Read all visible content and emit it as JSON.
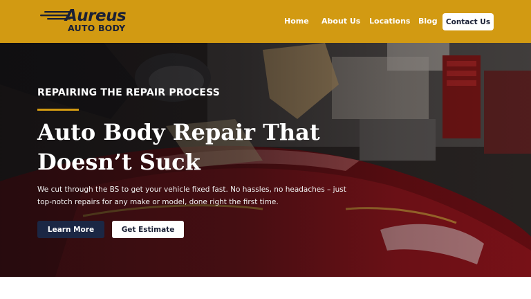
{
  "brand": {
    "logo_word": "Aureus",
    "logo_sub": "AUTO BODY",
    "colors": {
      "header_bg": "#d29a12",
      "navy": "#1b2744",
      "accent_rule": "#d29a12"
    }
  },
  "nav": {
    "items": [
      {
        "label": "Home"
      },
      {
        "label": "About Us"
      },
      {
        "label": "Locations"
      },
      {
        "label": "Blog"
      }
    ],
    "cta_label": "Contact Us"
  },
  "hero": {
    "eyebrow": "REPAIRING THE REPAIR PROCESS",
    "headline_line1": "Auto Body Repair That",
    "headline_line2": "Doesn’t Suck",
    "subtext": "We cut through the BS to get your vehicle fixed fast. No hassles, no headaches – just top-notch repairs for any make or model, done right the first time.",
    "primary_button": "Learn More",
    "secondary_button": "Get Estimate",
    "background_image": "auto body shop worker sanding red car panel"
  }
}
